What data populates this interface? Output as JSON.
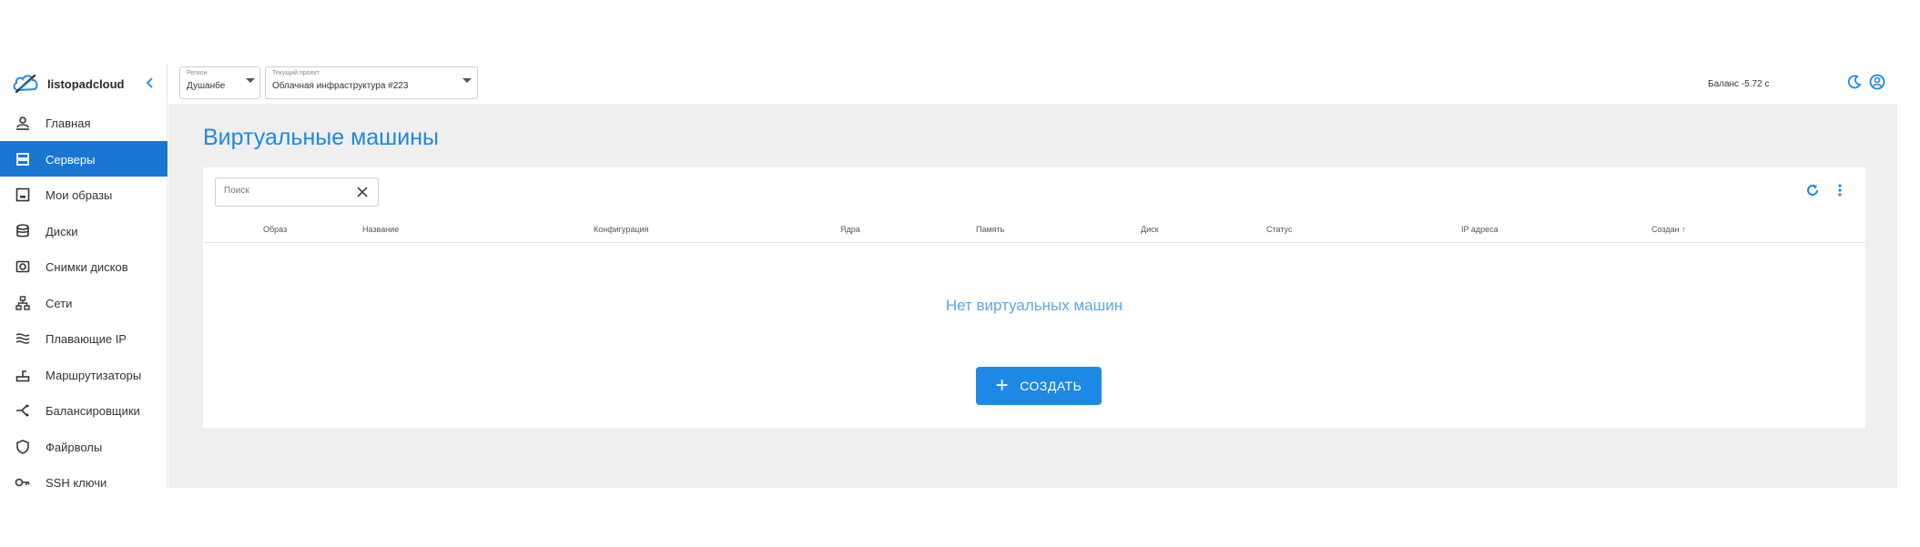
{
  "brand": {
    "name": "listopadcloud",
    "collapse_icon": "chevron-left-icon"
  },
  "header": {
    "region": {
      "caption": "Регион",
      "value": "Душанбе"
    },
    "project": {
      "caption": "Текущий проект",
      "value": "Облачная инфраструктура #223"
    },
    "balance": "Баланс -5.72 с",
    "icons": [
      "theme-moon-icon",
      "account-icon"
    ]
  },
  "sidebar": {
    "items": [
      {
        "label": "Главная",
        "icon": "home-user-icon",
        "active": false
      },
      {
        "label": "Серверы",
        "icon": "servers-icon",
        "active": true
      },
      {
        "label": "Мои образы",
        "icon": "image-icon",
        "active": false
      },
      {
        "label": "Диски",
        "icon": "database-icon",
        "active": false
      },
      {
        "label": "Снимки дисков",
        "icon": "camera-icon",
        "active": false
      },
      {
        "label": "Сети",
        "icon": "network-icon",
        "active": false
      },
      {
        "label": "Плавающие IP",
        "icon": "waves-icon",
        "active": false
      },
      {
        "label": "Маршрутизаторы",
        "icon": "router-icon",
        "active": false
      },
      {
        "label": "Балансировщики",
        "icon": "balancer-icon",
        "active": false
      },
      {
        "label": "Файрволы",
        "icon": "shield-icon",
        "active": false
      },
      {
        "label": "SSH ключи",
        "icon": "key-icon",
        "active": false
      }
    ]
  },
  "main": {
    "title": "Виртуальные машины",
    "search": {
      "placeholder": "Поиск",
      "value": ""
    },
    "columns": [
      "Образ",
      "Название",
      "Конфигурация",
      "Ядра",
      "Память",
      "Диск",
      "Статус",
      "IP адреса",
      "Создан"
    ],
    "sort_indicator": "↑",
    "empty_text": "Нет виртуальных машин",
    "create_label": "СОЗДАТЬ"
  },
  "colors": {
    "accent": "#1e88e5",
    "active_nav": "#1976d2",
    "background": "#efefef"
  }
}
